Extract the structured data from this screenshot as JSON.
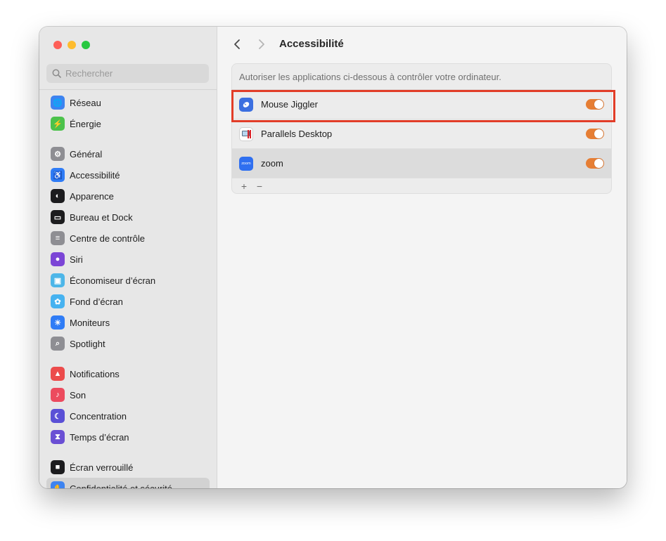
{
  "search": {
    "placeholder": "Rechercher"
  },
  "sidebar": {
    "groups": [
      [
        {
          "label": "Réseau",
          "icon": "globe-icon",
          "color": "#3d83f0"
        },
        {
          "label": "Énergie",
          "icon": "battery-icon",
          "color": "#4cc24b"
        }
      ],
      [
        {
          "label": "Général",
          "icon": "gear-icon",
          "color": "#8e8e93"
        },
        {
          "label": "Accessibilité",
          "icon": "accessibility-icon",
          "color": "#2f7cf6"
        },
        {
          "label": "Apparence",
          "icon": "appearance-icon",
          "color": "#1c1c1e"
        },
        {
          "label": "Bureau et Dock",
          "icon": "dock-icon",
          "color": "#1c1c1e"
        },
        {
          "label": "Centre de contrôle",
          "icon": "control-center-icon",
          "color": "#8e8e93"
        },
        {
          "label": "Siri",
          "icon": "siri-icon",
          "color": "#7b45d6"
        },
        {
          "label": "Économiseur d’écran",
          "icon": "screensaver-icon",
          "color": "#4db6e8"
        },
        {
          "label": "Fond d’écran",
          "icon": "wallpaper-icon",
          "color": "#46b2f0"
        },
        {
          "label": "Moniteurs",
          "icon": "display-icon",
          "color": "#2f7cf6"
        },
        {
          "label": "Spotlight",
          "icon": "spotlight-icon",
          "color": "#8e8e93"
        }
      ],
      [
        {
          "label": "Notifications",
          "icon": "notifications-icon",
          "color": "#ec4b4b"
        },
        {
          "label": "Son",
          "icon": "sound-icon",
          "color": "#ec4b5e"
        },
        {
          "label": "Concentration",
          "icon": "focus-icon",
          "color": "#5a50d6"
        },
        {
          "label": "Temps d’écran",
          "icon": "screen-time-icon",
          "color": "#6a4fd4"
        }
      ],
      [
        {
          "label": "Écran verrouillé",
          "icon": "lock-icon",
          "color": "#1c1c1e"
        },
        {
          "label": "Confidentialité et sécurité",
          "icon": "privacy-hand-icon",
          "color": "#3d83f0",
          "selected": true
        }
      ]
    ]
  },
  "main": {
    "title": "Accessibilité",
    "description": "Autoriser les applications ci-dessous à contrôler votre ordinateur.",
    "apps": [
      {
        "name": "Mouse Jiggler",
        "icon": "mouse-jiggler-icon",
        "enabled": true
      },
      {
        "name": "Parallels Desktop",
        "icon": "parallels-desktop-icon",
        "enabled": true
      },
      {
        "name": "zoom",
        "icon": "zoom-icon",
        "icon_text": "zoom",
        "enabled": true
      }
    ],
    "add_label": "+",
    "remove_label": "−"
  },
  "colors": {
    "accent_toggle": "#e67e34",
    "highlight": "#e23d28",
    "traffic_red": "#fe5f57",
    "traffic_yellow": "#febc2e",
    "traffic_green": "#28c840"
  }
}
